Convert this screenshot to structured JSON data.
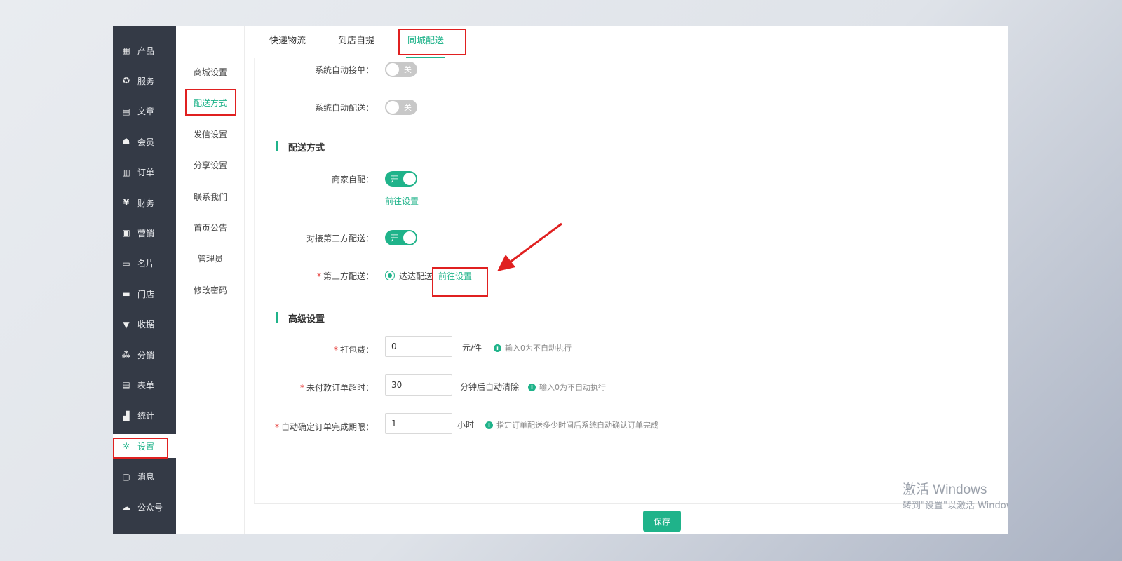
{
  "sidebar": {
    "items": [
      {
        "label": "产品",
        "icon": "grid-icon",
        "glyph": "▦"
      },
      {
        "label": "服务",
        "icon": "service-icon",
        "glyph": "✪"
      },
      {
        "label": "文章",
        "icon": "document-icon",
        "glyph": "▤"
      },
      {
        "label": "会员",
        "icon": "member-icon",
        "glyph": "☗"
      },
      {
        "label": "订单",
        "icon": "order-icon",
        "glyph": "▥"
      },
      {
        "label": "财务",
        "icon": "yen-icon",
        "glyph": "¥"
      },
      {
        "label": "营销",
        "icon": "gift-icon",
        "glyph": "▣"
      },
      {
        "label": "名片",
        "icon": "card-icon",
        "glyph": "▭"
      },
      {
        "label": "门店",
        "icon": "store-icon",
        "glyph": "▬"
      },
      {
        "label": "收据",
        "icon": "receipt-icon",
        "glyph": "▼"
      },
      {
        "label": "分销",
        "icon": "distribution-icon",
        "glyph": "⁂"
      },
      {
        "label": "表单",
        "icon": "form-icon",
        "glyph": "▤"
      },
      {
        "label": "统计",
        "icon": "chart-icon",
        "glyph": "▟"
      },
      {
        "label": "设置",
        "icon": "gear-icon",
        "glyph": "✲"
      },
      {
        "label": "消息",
        "icon": "message-icon",
        "glyph": "▢"
      },
      {
        "label": "公众号",
        "icon": "wechat-icon",
        "glyph": "☁"
      }
    ],
    "active_index": 13
  },
  "submenu": {
    "items": [
      "商城设置",
      "配送方式",
      "发信设置",
      "分享设置",
      "联系我们",
      "首页公告",
      "管理员",
      "修改密码"
    ],
    "active_index": 1
  },
  "tabs": [
    "快递物流",
    "到店自提",
    "同城配送"
  ],
  "tabs_active_index": 2,
  "form": {
    "auto_accept": {
      "label": "系统自动接单：",
      "state": "关"
    },
    "auto_delivery": {
      "label": "系统自动配送：",
      "state": "关"
    },
    "section_delivery": "配送方式",
    "merchant_self": {
      "label": "商家自配：",
      "state": "开",
      "link": "前往设置"
    },
    "third_party_toggle": {
      "label": "对接第三方配送：",
      "state": "开"
    },
    "third_party": {
      "required": "*",
      "label": "第三方配送：",
      "option": "达达配送",
      "link": "前往设置"
    },
    "section_advanced": "高级设置",
    "packing_fee": {
      "required": "*",
      "label": "打包费：",
      "value": "0",
      "unit": "元/件",
      "hint": "输入0为不自动执行"
    },
    "unpaid_timeout": {
      "required": "*",
      "label": "未付款订单超时：",
      "value": "30",
      "unit": "分钟后自动清除",
      "hint": "输入0为不自动执行"
    },
    "auto_confirm": {
      "required": "*",
      "label": "自动确定订单完成期限：",
      "value": "1",
      "unit": "小时",
      "hint": "指定订单配送多少时间后系统自动确认订单完成"
    }
  },
  "footer": {
    "save_label": "保存"
  },
  "watermark": {
    "line1": "激活 Windows",
    "line2": "转到\"设置\"以激活 Windows。"
  },
  "colors": {
    "accent": "#1fb38a",
    "sidebar_bg": "#343a46",
    "highlight": "#e02020"
  }
}
